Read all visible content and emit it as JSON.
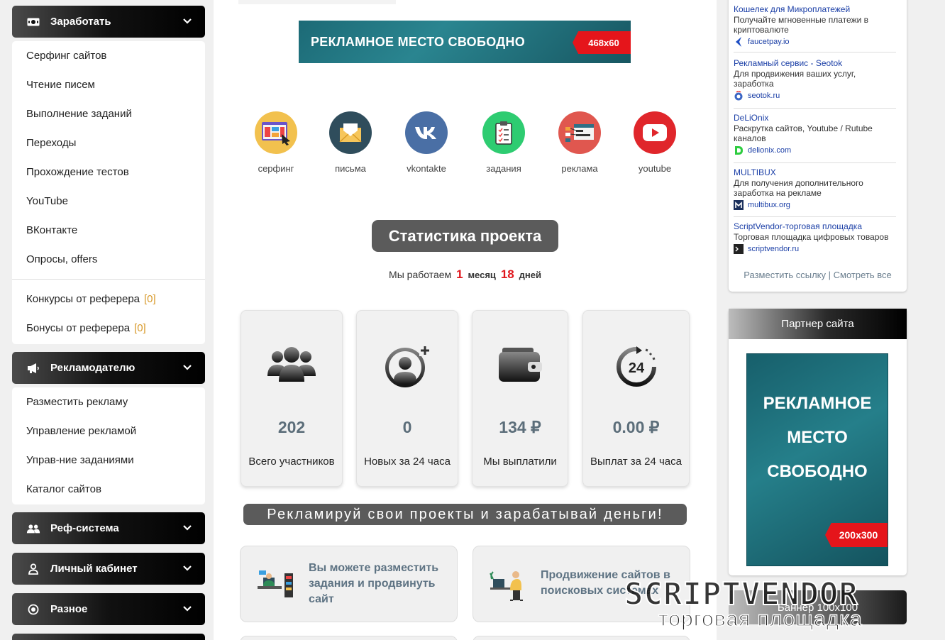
{
  "left": {
    "earn": {
      "title": "Заработать",
      "items": [
        "Серфинг сайтов",
        "Чтение писем",
        "Выполнение заданий",
        "Переходы",
        "Прохождение тестов",
        "YouTube",
        "ВКонтакте",
        "Опросы, offers"
      ],
      "ref_items": [
        {
          "label": "Конкурсы от реферера",
          "count": "[0]"
        },
        {
          "label": "Бонусы от реферера",
          "count": "[0]"
        }
      ]
    },
    "advertiser": {
      "title": "Рекламодателю",
      "items": [
        "Разместить рекламу",
        "Управление рекламой",
        "Управ-ние заданиями",
        "Каталог сайтов"
      ]
    },
    "ref_system": {
      "title": "Реф-система"
    },
    "cabinet": {
      "title": "Личный кабинет"
    },
    "misc": {
      "title": "Разное"
    }
  },
  "center": {
    "banner_top": {
      "text": "РЕКЛАМНОЕ  МЕСТО СВОБОДНО",
      "size": "468x60"
    },
    "categories": [
      {
        "label": "серфинг",
        "icon": "surfing-icon",
        "color": "#f2c14e"
      },
      {
        "label": "письма",
        "icon": "envelope-icon",
        "color": "#2f4d5c"
      },
      {
        "label": "vkontakte",
        "icon": "vk-icon",
        "color": "#4a6fa5"
      },
      {
        "label": "задания",
        "icon": "clipboard-icon",
        "color": "#2ecc71"
      },
      {
        "label": "реклама",
        "icon": "ads-icon",
        "color": "#e0574f"
      },
      {
        "label": "youtube",
        "icon": "youtube-icon",
        "color": "#e0262b"
      }
    ],
    "stats_title": "Статистика проекта",
    "working": {
      "prefix": "Мы работаем",
      "months": "1",
      "months_unit": "месяц",
      "days": "18",
      "days_unit": "дней"
    },
    "stats": [
      {
        "value": "202",
        "caption": "Всего участников",
        "icon": "users-icon"
      },
      {
        "value": "0",
        "caption": "Новых за 24 часа",
        "icon": "add-user-icon"
      },
      {
        "value": "134 ₽",
        "caption": "Мы выплатили",
        "icon": "wallet-icon"
      },
      {
        "value": "0.00 ₽",
        "caption": "Выплат за 24 часа",
        "icon": "24h-icon"
      }
    ],
    "slogan": "Рекламируй свои проекты и зарабатывай деньги!",
    "promos": [
      {
        "text": "Вы можете разместить задания и продвинуть сайт",
        "icon": "office-worker-icon"
      },
      {
        "text": "Продвижение сайтов в поисковых системах",
        "icon": "seo-worker-icon"
      }
    ]
  },
  "right": {
    "ads": [
      {
        "title": "Кошелек для Микроплатежей",
        "desc": "Получайте мгновенные платежи в криптовалюте",
        "site": "faucetpay.io",
        "fav": "faucetpay-icon"
      },
      {
        "title": "Рекламный сервис - Seotok",
        "desc": "Для продвижения ваших услуг, заработка",
        "site": "seotok.ru",
        "fav": "seotok-icon"
      },
      {
        "title": "DeLiOnix",
        "desc": "Раскрутка сайтов, Youtube / Rutube каналов",
        "site": "delionix.com",
        "fav": "delionix-icon"
      },
      {
        "title": "MULTIBUX",
        "desc": "Для получения дополнительного заработка на рекламе",
        "site": "multibux.org",
        "fav": "multibux-icon"
      },
      {
        "title": "ScriptVendor-торговая площадка",
        "desc": "Торговая площадка цифровых товаров",
        "site": "scriptvendor.ru",
        "fav": "scriptvendor-icon"
      }
    ],
    "links_footer": {
      "place": "Разместить ссылку",
      "sep": " | ",
      "view_all": "Смотреть все"
    },
    "partner_title": "Партнер сайта",
    "banner300": {
      "line1": "РЕКЛАМНОЕ",
      "line2": "МЕСТО",
      "line3": "СВОБОДНО",
      "size": "200x300"
    },
    "banner100_label": "Баннер 100x100"
  },
  "watermark": {
    "brand": "SCRIPTVENDOR",
    "sub": "торговая площадка"
  }
}
